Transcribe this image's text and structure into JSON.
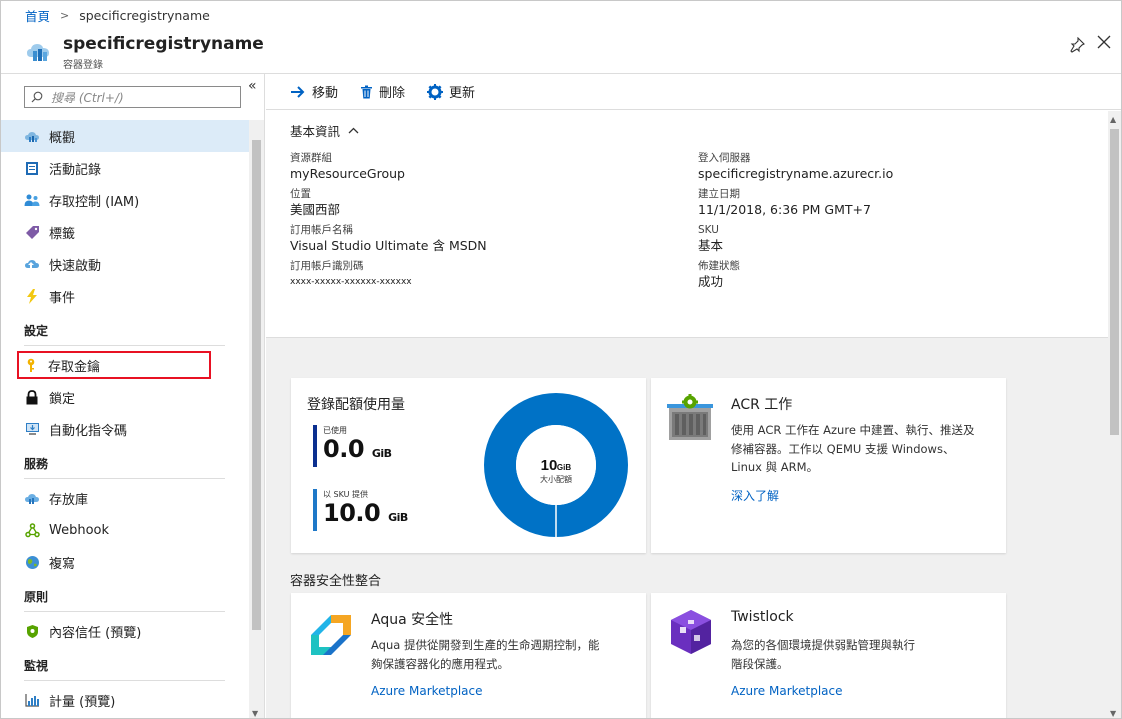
{
  "breadcrumb": {
    "home": "首頁",
    "current": "specificregistryname"
  },
  "header": {
    "title": "specificregistryname",
    "subtitle": "容器登錄"
  },
  "sidebar": {
    "search_placeholder": "搜尋 (Ctrl+/)",
    "items": [
      {
        "label": "概觀",
        "icon": "cloud-icon",
        "active": true
      },
      {
        "label": "活動記錄",
        "icon": "activity-log-icon"
      },
      {
        "label": "存取控制 (IAM)",
        "icon": "iam-icon"
      },
      {
        "label": "標籤",
        "icon": "tag-icon"
      },
      {
        "label": "快速啟動",
        "icon": "quickstart-icon"
      },
      {
        "label": "事件",
        "icon": "lightning-icon"
      }
    ],
    "sections": {
      "settings": "設定",
      "services": "服務",
      "policies": "原則",
      "monitoring": "監視"
    },
    "settings_items": [
      {
        "label": "存取金鑰",
        "icon": "key-icon",
        "highlighted": true
      },
      {
        "label": "鎖定",
        "icon": "lock-icon"
      },
      {
        "label": "自動化指令碼",
        "icon": "automation-icon"
      }
    ],
    "services_items": [
      {
        "label": "存放庫",
        "icon": "repository-icon"
      },
      {
        "label": "Webhook",
        "icon": "webhook-icon"
      },
      {
        "label": "複寫",
        "icon": "globe-icon"
      }
    ],
    "policies_items": [
      {
        "label": "內容信任 (預覽)",
        "icon": "shield-icon"
      }
    ],
    "monitoring_items": [
      {
        "label": "計量 (預覽)",
        "icon": "metrics-icon"
      }
    ]
  },
  "toolbar": {
    "move": "移動",
    "delete": "刪除",
    "refresh": "更新"
  },
  "essentials": {
    "heading": "基本資訊",
    "left": [
      {
        "label": "資源群組",
        "value": "myResourceGroup",
        "link": true
      },
      {
        "label": "位置",
        "value": "美國西部"
      },
      {
        "label": "訂用帳戶名稱",
        "value": "Visual Studio Ultimate 含 MSDN",
        "link": true
      },
      {
        "label": "訂用帳戶識別碼",
        "value": "xxxx-xxxxx-xxxxxx-xxxxxx"
      }
    ],
    "right": [
      {
        "label": "登入伺服器",
        "value": "specificregistryname.azurecr.io"
      },
      {
        "label": "建立日期",
        "value": "11/1/2018, 6:36 PM GMT+7"
      },
      {
        "label": "SKU",
        "value": "基本"
      },
      {
        "label": "佈建狀態",
        "value": "成功"
      }
    ]
  },
  "usage_card": {
    "title": "登錄配額使用量",
    "used_label": "已使用",
    "used_value": "0.0",
    "used_unit": "GiB",
    "sku_label": "以 SKU 提供",
    "sku_value": "10.0",
    "sku_unit": "GiB",
    "donut_center_value": "10",
    "donut_center_unit": "GiB",
    "donut_center_label": "大小配額",
    "used_fraction": 0.0,
    "color": "#0072c6"
  },
  "acr_card": {
    "title": "ACR 工作",
    "text_line1": "使用 ACR 工作在 Azure 中建置、執行、推送及",
    "text_line2": "修補容器。工作以 QEMU 支援 Windows、",
    "text_line3": "Linux 與 ARM。",
    "link": "深入了解"
  },
  "security_section": {
    "title": "容器安全性整合"
  },
  "aqua_card": {
    "title": "Aqua 安全性",
    "text_line1": "Aqua 提供從開發到生產的生命週期控制，能",
    "text_line2": "夠保護容器化的應用程式。",
    "link": "Azure Marketplace"
  },
  "twistlock_card": {
    "title": "Twistlock",
    "text_line1": "為您的各個環境提供弱點管理與執行",
    "text_line2": "階段保護。",
    "link": "Azure Marketplace"
  }
}
